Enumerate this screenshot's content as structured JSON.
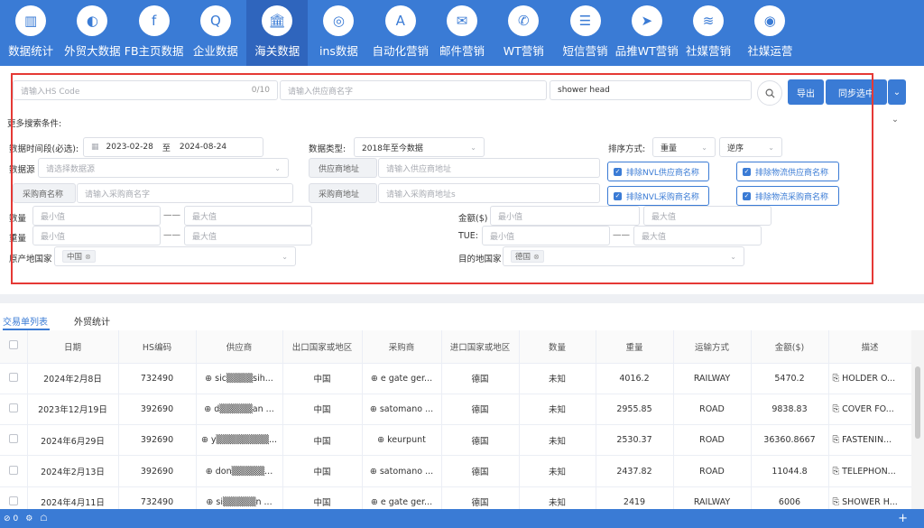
{
  "nav": [
    {
      "label": "数据统计",
      "icon": "chart-icon",
      "active": false
    },
    {
      "label": "外贸大数据",
      "icon": "globe-icon",
      "active": false
    },
    {
      "label": "FB主页数据",
      "icon": "fb-icon",
      "active": false
    },
    {
      "label": "企业数据",
      "icon": "enterprise-icon",
      "active": false
    },
    {
      "label": "海关数据",
      "icon": "customs-icon",
      "active": true
    },
    {
      "label": "ins数据",
      "icon": "ins-icon",
      "active": false
    },
    {
      "label": "自动化营销",
      "icon": "automation-icon",
      "active": false
    },
    {
      "label": "邮件营销",
      "icon": "mail-icon",
      "active": false
    },
    {
      "label": "WT营销",
      "icon": "whatsapp-icon",
      "active": false
    },
    {
      "label": "短信营销",
      "icon": "sms-icon",
      "active": false
    },
    {
      "label": "品推WT营销",
      "icon": "telegram-icon",
      "active": false
    },
    {
      "label": "社媒营销",
      "icon": "layers-icon",
      "active": false
    },
    {
      "label": "社媒运营",
      "icon": "social-ops-icon",
      "active": false
    }
  ],
  "search": {
    "hs_placeholder": "请输入HS Code",
    "hs_count": "0/10",
    "supplier_placeholder": "请输入供应商名字",
    "keyword_value": "shower head",
    "export_label": "导出",
    "sync_label": "同步选中"
  },
  "filters": {
    "more_label": "更多搜索条件:",
    "date_label": "数据时间段(必选):",
    "date_start": "2023-02-28",
    "date_sep": "至",
    "date_end": "2024-08-24",
    "data_type_label": "数据类型:",
    "data_type_value": "2018年至今数据",
    "sort_label": "排序方式:",
    "sort_field": "重量",
    "sort_order": "逆序",
    "source_label": "数据源",
    "source_placeholder": "请选择数据源",
    "supplier_addr_label": "供应商地址",
    "supplier_addr_placeholder": "请输入供应商地址",
    "buyer_name_label": "采购商名称",
    "buyer_name_placeholder": "请输入采购商名字",
    "buyer_addr_label": "采购商地址",
    "buyer_addr_placeholder": "请输入采购商地址s",
    "excl_nvl_supplier": "排除NVL供应商名称",
    "excl_logistics_supplier": "排除物流供应商名称",
    "excl_nvl_buyer": "排除NVL采购商名称",
    "excl_logistics_buyer": "排除物流采购商名称",
    "qty_label": "数量",
    "weight_label": "重量",
    "amount_label": "金额($)",
    "tue_label": "TUE:",
    "min_placeholder": "最小值",
    "max_placeholder": "最大值",
    "dash": "——",
    "origin_label": "原产地国家",
    "origin_chip": "中国",
    "dest_label": "目的地国家",
    "dest_chip": "德国"
  },
  "tabs": [
    {
      "label": "交易单列表",
      "active": true
    },
    {
      "label": "外贸统计",
      "active": false
    }
  ],
  "table": {
    "headers": [
      "日期",
      "HS编码",
      "供应商",
      "出口国家或地区",
      "采购商",
      "进口国家或地区",
      "数量",
      "重量",
      "运输方式",
      "金额($)",
      "描述"
    ],
    "rows": [
      [
        "2024年2月8日",
        "732490",
        "sic▒▒▒▒sih...",
        "中国",
        "e gate ger...",
        "德国",
        "未知",
        "4016.2",
        "RAILWAY",
        "5470.2",
        "HOLDER O..."
      ],
      [
        "2023年12月19日",
        "392690",
        "d▒▒▒▒▒an ...",
        "中国",
        "satomano ...",
        "德国",
        "未知",
        "2955.85",
        "ROAD",
        "9838.83",
        "COVER FO..."
      ],
      [
        "2024年6月29日",
        "392690",
        "y▒▒▒▒▒▒▒▒...",
        "中国",
        "keurpunt",
        "德国",
        "未知",
        "2530.37",
        "ROAD",
        "36360.8667",
        "FASTENIN..."
      ],
      [
        "2024年2月13日",
        "392690",
        "don▒▒▒▒▒...",
        "中国",
        "satomano ...",
        "德国",
        "未知",
        "2437.82",
        "ROAD",
        "11044.8",
        "TELEPHON..."
      ],
      [
        "2024年4月11日",
        "732490",
        "si▒▒▒▒▒n ...",
        "中国",
        "e gate ger...",
        "德国",
        "未知",
        "2419",
        "RAILWAY",
        "6006",
        "SHOWER H..."
      ]
    ]
  },
  "status": {
    "count": "0",
    "plus": "+"
  },
  "colors": {
    "primary": "#3a7bd5",
    "highlight": "#e53935"
  }
}
